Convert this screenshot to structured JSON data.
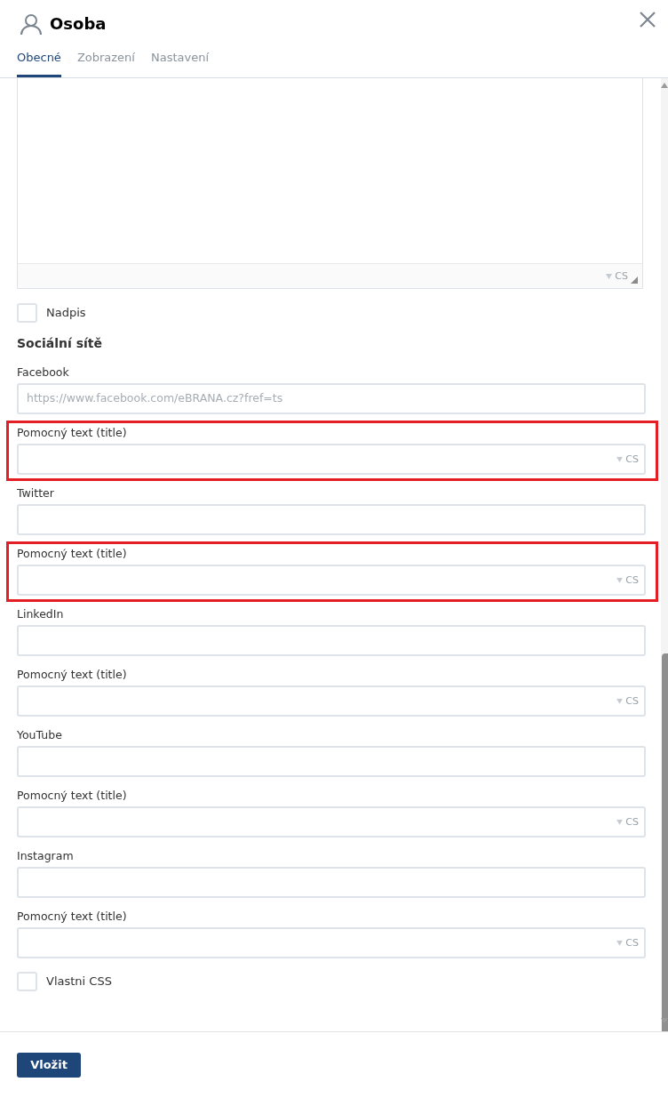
{
  "dialog": {
    "title": "Osoba"
  },
  "tabs": [
    {
      "label": "Obecné",
      "selected": true
    },
    {
      "label": "Zobrazení",
      "selected": false
    },
    {
      "label": "Nastavení",
      "selected": false
    }
  ],
  "editor": {
    "lang": "CS"
  },
  "checkboxes_top": [
    {
      "label": "Nadpis",
      "checked": false
    }
  ],
  "section_title": "Sociální sítě",
  "fields": [
    {
      "label": "Facebook",
      "kind": "url",
      "placeholder": "https://www.facebook.com/eBRANA.cz?fref=ts",
      "highlighted": false
    },
    {
      "label": "Pomocný text (title)",
      "kind": "title",
      "lang": "CS",
      "highlighted": true
    },
    {
      "label": "Twitter",
      "kind": "url",
      "highlighted": false
    },
    {
      "label": "Pomocný text (title)",
      "kind": "title",
      "lang": "CS",
      "highlighted": true
    },
    {
      "label": "LinkedIn",
      "kind": "url",
      "highlighted": false
    },
    {
      "label": "Pomocný text (title)",
      "kind": "title",
      "lang": "CS",
      "highlighted": false
    },
    {
      "label": "YouTube",
      "kind": "url",
      "highlighted": false
    },
    {
      "label": "Pomocný text (title)",
      "kind": "title",
      "lang": "CS",
      "highlighted": false
    },
    {
      "label": "Instagram",
      "kind": "url",
      "highlighted": false
    },
    {
      "label": "Pomocný text (title)",
      "kind": "title",
      "lang": "CS",
      "highlighted": false
    }
  ],
  "checkboxes_bottom": [
    {
      "label": "Vlastni CSS",
      "checked": false
    }
  ],
  "submit": "Vložit"
}
